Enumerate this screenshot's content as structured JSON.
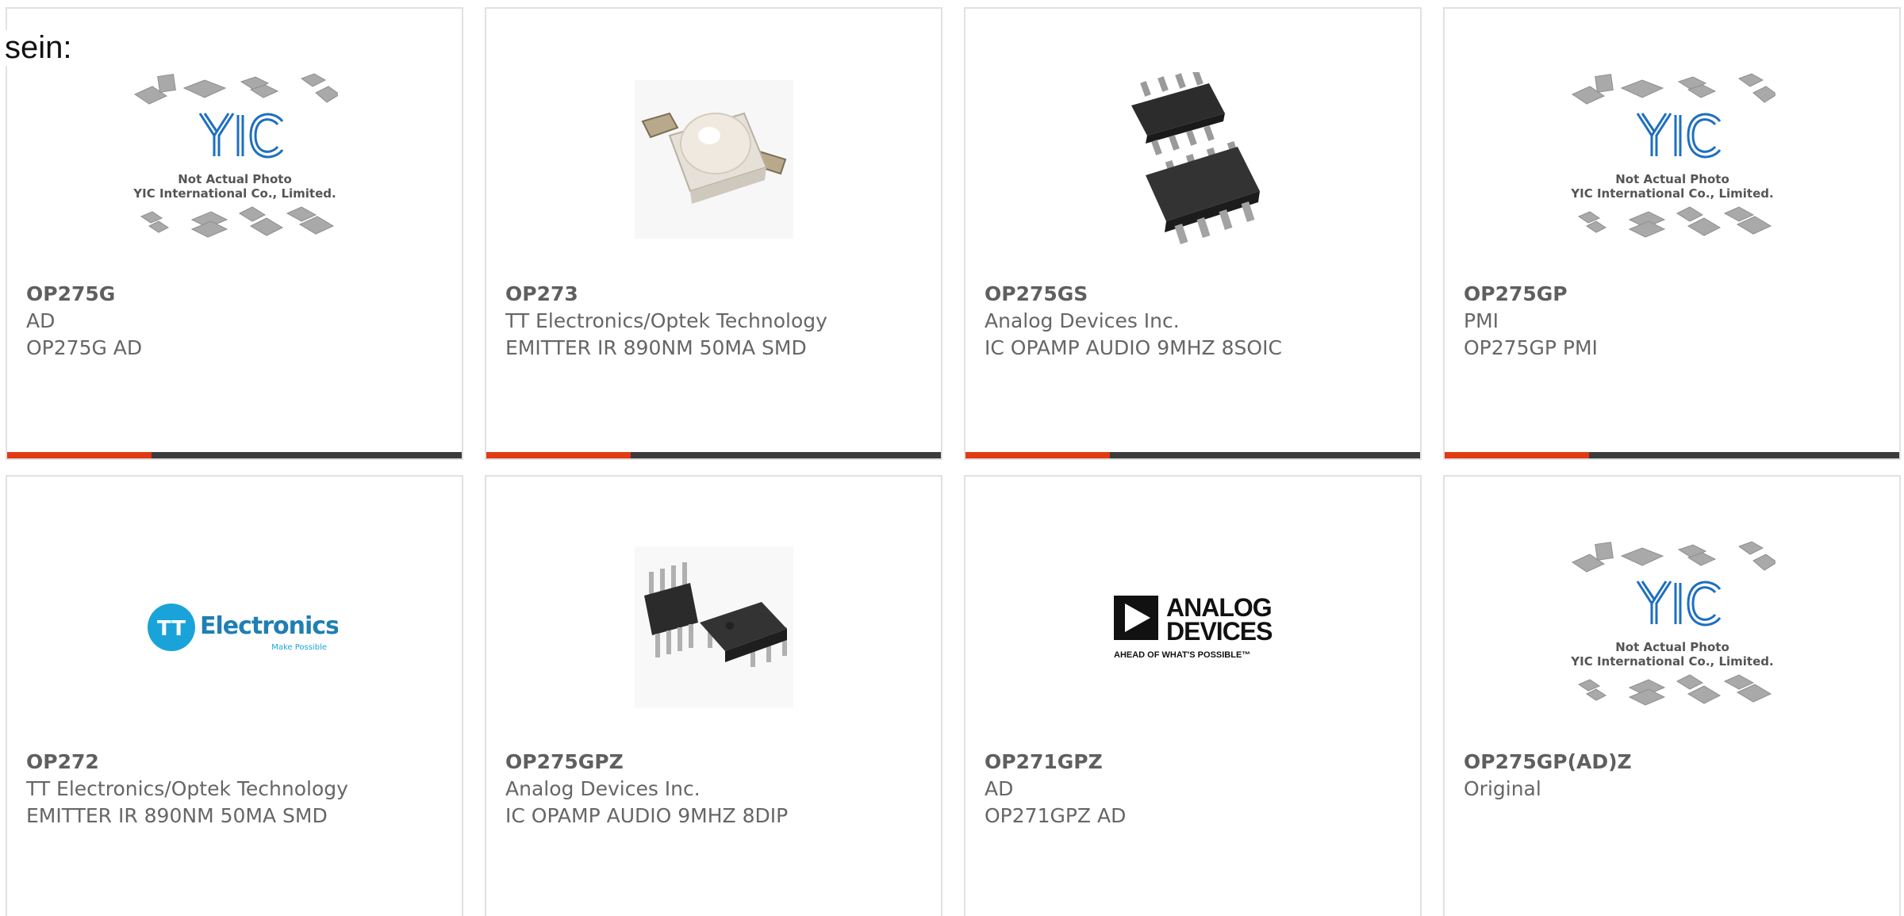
{
  "intro_text": "sein:",
  "colors": {
    "accent": "#e23a12",
    "bar": "#3c3c3c",
    "card_border": "#e1e1e1",
    "text": "#666666",
    "tt_blue": "#1aa3d9",
    "yic_blue": "#1e6fc0"
  },
  "placeholder": {
    "logo": "YIC",
    "line1": "Not Actual Photo",
    "line2": "YIC International Co., Limited."
  },
  "brand_logos": {
    "tt": {
      "mark": "TT",
      "name": "Electronics",
      "tagline": "Make Possible"
    },
    "adi": {
      "line1": "ANALOG",
      "line2": "DEVICES",
      "tagline": "AHEAD OF WHAT'S POSSIBLE™"
    }
  },
  "products": [
    {
      "part": "OP275G",
      "manufacturer": "AD",
      "description": "OP275G AD",
      "image": "yic-placeholder"
    },
    {
      "part": "OP273",
      "manufacturer": "TT Electronics/Optek Technology",
      "description": "EMITTER IR 890NM 50MA SMD",
      "image": "ir-emitter-photo"
    },
    {
      "part": "OP275GS",
      "manufacturer": "Analog Devices Inc.",
      "description": "IC OPAMP AUDIO 9MHZ 8SOIC",
      "image": "soic-chip-photo"
    },
    {
      "part": "OP275GP",
      "manufacturer": "PMI",
      "description": "OP275GP PMI",
      "image": "yic-placeholder"
    },
    {
      "part": "OP272",
      "manufacturer": "TT Electronics/Optek Technology",
      "description": "EMITTER IR 890NM 50MA SMD",
      "image": "tt-electronics-logo"
    },
    {
      "part": "OP275GPZ",
      "manufacturer": "Analog Devices Inc.",
      "description": "IC OPAMP AUDIO 9MHZ 8DIP",
      "image": "dip-chip-photo"
    },
    {
      "part": "OP271GPZ",
      "manufacturer": "AD",
      "description": "OP271GPZ AD",
      "image": "analog-devices-logo"
    },
    {
      "part": "OP275GP(AD)Z",
      "manufacturer": "Original",
      "description": "",
      "image": "yic-placeholder"
    }
  ]
}
